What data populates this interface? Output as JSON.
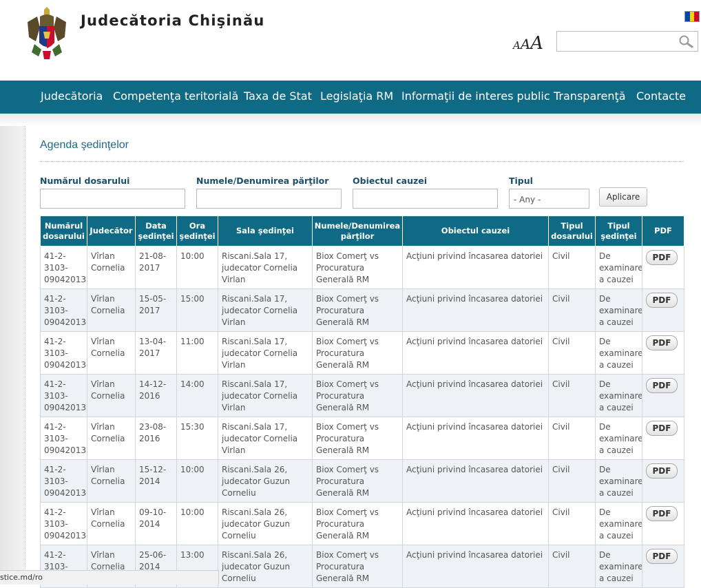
{
  "header": {
    "site_title": "Judecătoria Chişinău",
    "font_size_labels": [
      "A",
      "A",
      "A"
    ],
    "search_placeholder": "",
    "colors": {
      "nav_bg": "#0f6a86",
      "flag": [
        "#0046ae",
        "#ffd200",
        "#cc092f"
      ]
    }
  },
  "nav": {
    "items": [
      "Judecătoria",
      "Competenţa teritorială",
      "Taxa de Stat",
      "Legislaţia RM",
      "Informaţii de interes public",
      "Transparenţă",
      "Contacte"
    ]
  },
  "page": {
    "title": "Agenda şedinţelor"
  },
  "filters": {
    "case_number_label": "Numărul dosarului",
    "parties_label": "Numele/Denumirea părţilor",
    "subject_label": "Obiectul cauzei",
    "type_label": "Tipul",
    "type_value": "- Any -",
    "apply_label": "Aplicare"
  },
  "table": {
    "headers": [
      "Numărul dosarului",
      "Judecător",
      "Data şedinţei",
      "Ora şedinţei",
      "Sala şedinţei",
      "Numele/Denumirea părţilor",
      "Obiectul cauzei",
      "Tipul dosarului",
      "Tipul şedinţei",
      "PDF"
    ],
    "pdf_label": "PDF",
    "rows": [
      {
        "case": "41-2-3103-09042013",
        "judge": "Vîrlan Cornelia",
        "date": "21-08-2017",
        "time": "10:00",
        "room": "Riscani.Sala 17, judecator Cornelia Virlan",
        "parties": "Biox Comerţ vs Procuratura Generală RM",
        "subject": "Acţiuni privind încasarea datoriei",
        "case_type": "Civil",
        "hearing_type": "De examinare a cauzei"
      },
      {
        "case": "41-2-3103-09042013",
        "judge": "Vîrlan Cornelia",
        "date": "15-05-2017",
        "time": "15:00",
        "room": "Riscani.Sala 17, judecator Cornelia Virlan",
        "parties": "Biox Comerţ vs Procuratura Generală RM",
        "subject": "Acţiuni privind încasarea datoriei",
        "case_type": "Civil",
        "hearing_type": "De examinare a cauzei"
      },
      {
        "case": "41-2-3103-09042013",
        "judge": "Vîrlan Cornelia",
        "date": "13-04-2017",
        "time": "11:00",
        "room": "Riscani.Sala 17, judecator Cornelia Virlan",
        "parties": "Biox Comerţ vs Procuratura Generală RM",
        "subject": "Acţiuni privind încasarea datoriei",
        "case_type": "Civil",
        "hearing_type": "De examinare a cauzei"
      },
      {
        "case": "41-2-3103-09042013",
        "judge": "Vîrlan Cornelia",
        "date": "14-12-2016",
        "time": "14:00",
        "room": "Riscani.Sala 17, judecator Cornelia Virlan",
        "parties": "Biox Comerţ vs Procuratura Generală RM",
        "subject": "Acţiuni privind încasarea datoriei",
        "case_type": "Civil",
        "hearing_type": "De examinare a cauzei"
      },
      {
        "case": "41-2-3103-09042013",
        "judge": "Vîrlan Cornelia",
        "date": "23-08-2016",
        "time": "15:30",
        "room": "Riscani.Sala 17, judecator Cornelia Virlan",
        "parties": "Biox Comerţ vs Procuratura Generală RM",
        "subject": "Acţiuni privind încasarea datoriei",
        "case_type": "Civil",
        "hearing_type": "De examinare a cauzei"
      },
      {
        "case": "41-2-3103-09042013",
        "judge": "Vîrlan Cornelia",
        "date": "15-12-2014",
        "time": "10:00",
        "room": "Riscani.Sala 26, judecator Guzun Corneliu",
        "parties": "Biox Comerţ vs Procuratura Generală RM",
        "subject": "Acţiuni privind încasarea datoriei",
        "case_type": "Civil",
        "hearing_type": "De examinare a cauzei"
      },
      {
        "case": "41-2-3103-09042013",
        "judge": "Vîrlan Cornelia",
        "date": "09-10-2014",
        "time": "10:00",
        "room": "Riscani.Sala 26, judecator Guzun Corneliu",
        "parties": "Biox Comerţ vs Procuratura Generală RM",
        "subject": "Acţiuni privind încasarea datoriei",
        "case_type": "Civil",
        "hearing_type": "De examinare a cauzei"
      },
      {
        "case": "41-2-3103-09042013",
        "judge": "Vîrlan Cornelia",
        "date": "25-06-2014",
        "time": "13:00",
        "room": "Riscani.Sala 26, judecator Guzun Corneliu",
        "parties": "Biox Comerţ vs Procuratura Generală RM",
        "subject": "Acţiuni privind încasarea datoriei",
        "case_type": "Civil",
        "hearing_type": "De examinare a cauzei"
      }
    ]
  },
  "statusbar": {
    "url": "stice.md/ro"
  }
}
